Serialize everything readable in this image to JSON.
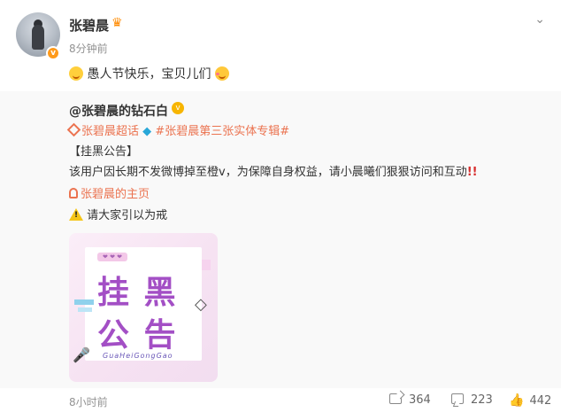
{
  "author": {
    "name": "张碧晨",
    "time": "8分钟前",
    "repost_text": "愚人节快乐，宝贝儿们"
  },
  "quoted": {
    "author": "@张碧晨的钻石白",
    "supertalk": "张碧晨超话",
    "topic": "#张碧晨第三张实体专辑#",
    "heading": "【挂黑公告】",
    "body": "该用户因长期不发微博掉至橙v，为保障自身权益，请小晨曦们狠狠访问和互动",
    "homepage": "张碧晨的主页",
    "warning": "请大家引以为戒",
    "poster": {
      "line1": "挂 黑",
      "line2": "公 告",
      "pinyin": "GuaHeiGongGao"
    }
  },
  "footer": {
    "time": "8小时前",
    "reposts": "364",
    "comments": "223",
    "likes": "442"
  }
}
